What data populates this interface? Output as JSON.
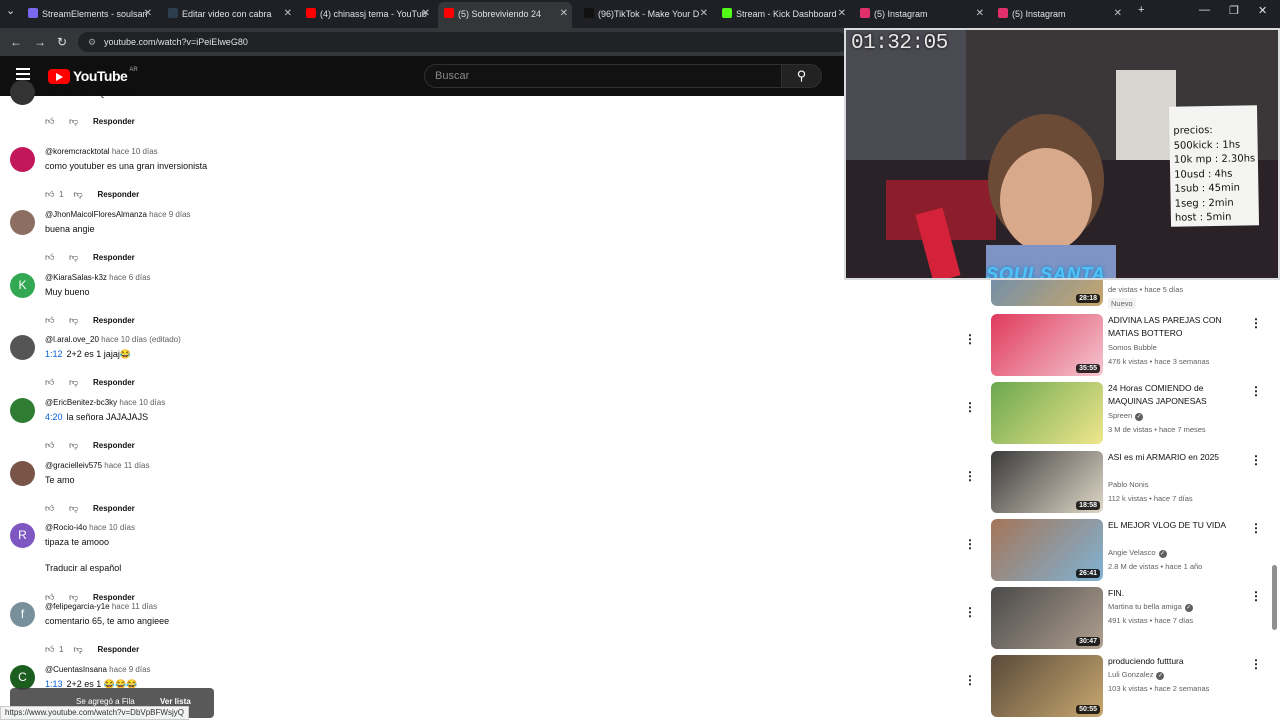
{
  "tabs": [
    {
      "label": "StreamElements - soulsan",
      "color": "#7b68ee"
    },
    {
      "label": "Editar video con cabra",
      "color": "#2c3e50"
    },
    {
      "label": "(4) chinassj tema - YouTub",
      "color": "#ff0000"
    },
    {
      "label": "(5) Sobreviviendo 24",
      "color": "#ff0000"
    },
    {
      "label": "(96)TikTok - Make Your D",
      "color": "#111111"
    },
    {
      "label": "Stream - Kick Dashboard",
      "color": "#53fc18"
    },
    {
      "label": "(5) Instagram",
      "color": "#e1306c"
    },
    {
      "label": "(5) Instagram",
      "color": "#e1306c"
    }
  ],
  "address": {
    "url": "youtube.com/watch?v=iPeiElweG80"
  },
  "youtube": {
    "logo": "YouTube",
    "region": "AR",
    "search_placeholder": "Buscar"
  },
  "comments": [
    {
      "user": "",
      "ago": "",
      "text": "ame el final JQJAJAJA",
      "timestamp": "",
      "likes": "",
      "reply": "Responder",
      "avatar_color": "#333333",
      "avatar_letter": ""
    },
    {
      "user": "@koremcracktotal",
      "ago": "hace 10 días",
      "text": "como youtuber es una gran inversionista",
      "timestamp": "",
      "likes": "1",
      "reply": "Responder",
      "avatar_color": "#c2185b",
      "avatar_letter": ""
    },
    {
      "user": "@JhonMaicolFloresAlmanza",
      "ago": "hace 9 días",
      "text": "buena angie",
      "timestamp": "",
      "likes": "",
      "reply": "Responder",
      "avatar_color": "#8d6e63",
      "avatar_letter": ""
    },
    {
      "user": "@KiaraSalas-k3z",
      "ago": "hace 6 días",
      "text": "Muy bueno",
      "timestamp": "",
      "likes": "",
      "reply": "Responder",
      "avatar_color": "#33a852",
      "avatar_letter": "K"
    },
    {
      "user": "@l.aral.ove_20",
      "ago": "hace 10 días (editado)",
      "text": "2+2 es 1 jajaj😂",
      "timestamp": "1:12",
      "likes": "",
      "reply": "Responder",
      "avatar_color": "#555555",
      "avatar_letter": ""
    },
    {
      "user": "@EricBenitez-bc3ky",
      "ago": "hace 10 días",
      "text": "la señora JAJAJAJS",
      "timestamp": "4:20",
      "likes": "",
      "reply": "Responder",
      "avatar_color": "#2e7d32",
      "avatar_letter": ""
    },
    {
      "user": "@gracielleiv575",
      "ago": "hace 11 días",
      "text": "Te amo",
      "timestamp": "",
      "likes": "",
      "reply": "Responder",
      "avatar_color": "#795548",
      "avatar_letter": ""
    },
    {
      "user": "@Rocio-i4o",
      "ago": "hace 10 días",
      "text": "tipaza te amooo",
      "timestamp": "",
      "likes": "",
      "reply": "Responder",
      "avatar_color": "#7e57c2",
      "avatar_letter": "R",
      "translate": "Traducir al español"
    },
    {
      "user": "@felipegarcia-y1e",
      "ago": "hace 11 días",
      "text": "comentario 65, te amo angieee",
      "timestamp": "",
      "likes": "1",
      "reply": "Responder",
      "avatar_color": "#78909c",
      "avatar_letter": "f"
    },
    {
      "user": "@CuentasInsana",
      "ago": "hace 9 días",
      "text": "2+2 es 1 😂😂😂",
      "timestamp": "1:13",
      "likes": "",
      "reply": "",
      "avatar_color": "#1b5e20",
      "avatar_letter": "C"
    }
  ],
  "recommendations": [
    {
      "title": "",
      "channel": "Nuevo",
      "meta": "de vistas • hace 5 días",
      "duration": "28:18",
      "verified": false,
      "colors": [
        "#5d8ab8",
        "#c9a66b"
      ]
    },
    {
      "title": "ADIVINA LAS PAREJAS CON MATIAS BOTTERO",
      "channel": "Somos Bubble",
      "meta": "476 k vistas • hace 3 semanas",
      "duration": "35:55",
      "verified": false,
      "colors": [
        "#e03a5c",
        "#f4c6d0"
      ]
    },
    {
      "title": "24 Horas COMIENDO de MAQUINAS JAPONESAS",
      "channel": "Spreen",
      "meta": "3 M de vistas • hace 7 meses",
      "duration": "",
      "verified": true,
      "colors": [
        "#6aa84f",
        "#f0e68c"
      ]
    },
    {
      "title": "ASI es mi ARMARIO en 2025",
      "channel": "Pablo Nonis",
      "meta": "112 k vistas • hace 7 días",
      "duration": "18:58",
      "verified": false,
      "colors": [
        "#3a3a3a",
        "#e0d8c8"
      ]
    },
    {
      "title": "EL MEJOR VLOG DE TU VIDA",
      "channel": "Angie Velasco",
      "meta": "2.8 M de vistas • hace 1 año",
      "duration": "26:41",
      "verified": true,
      "colors": [
        "#a57558",
        "#7fb3d5"
      ]
    },
    {
      "title": "FIN.",
      "channel": "Martina tu bella amiga",
      "meta": "491 k vistas • hace 7 días",
      "duration": "30:47",
      "verified": true,
      "colors": [
        "#4a4a4a",
        "#b0a090"
      ]
    },
    {
      "title": "produciendo futttura",
      "channel": "Luli Gonzalez",
      "meta": "103 k vistas • hace 2 semanas",
      "duration": "50:55",
      "verified": true,
      "colors": [
        "#5a4a3a",
        "#c8a870"
      ]
    }
  ],
  "overlay": {
    "timer": "01:32:05",
    "note": [
      "precios:",
      "500kick : 1hs",
      "10k mp : 2.30hs",
      "10usd : 4hs",
      "1sub : 45min",
      "1seg : 2min",
      "host : 5min"
    ],
    "logo": "SOULSANTA"
  },
  "toast": {
    "message": "Se agregó a Fila",
    "action": "Ver lista"
  },
  "status_url": "https://www.youtube.com/watch?v=DbVpBFWsjyQ"
}
